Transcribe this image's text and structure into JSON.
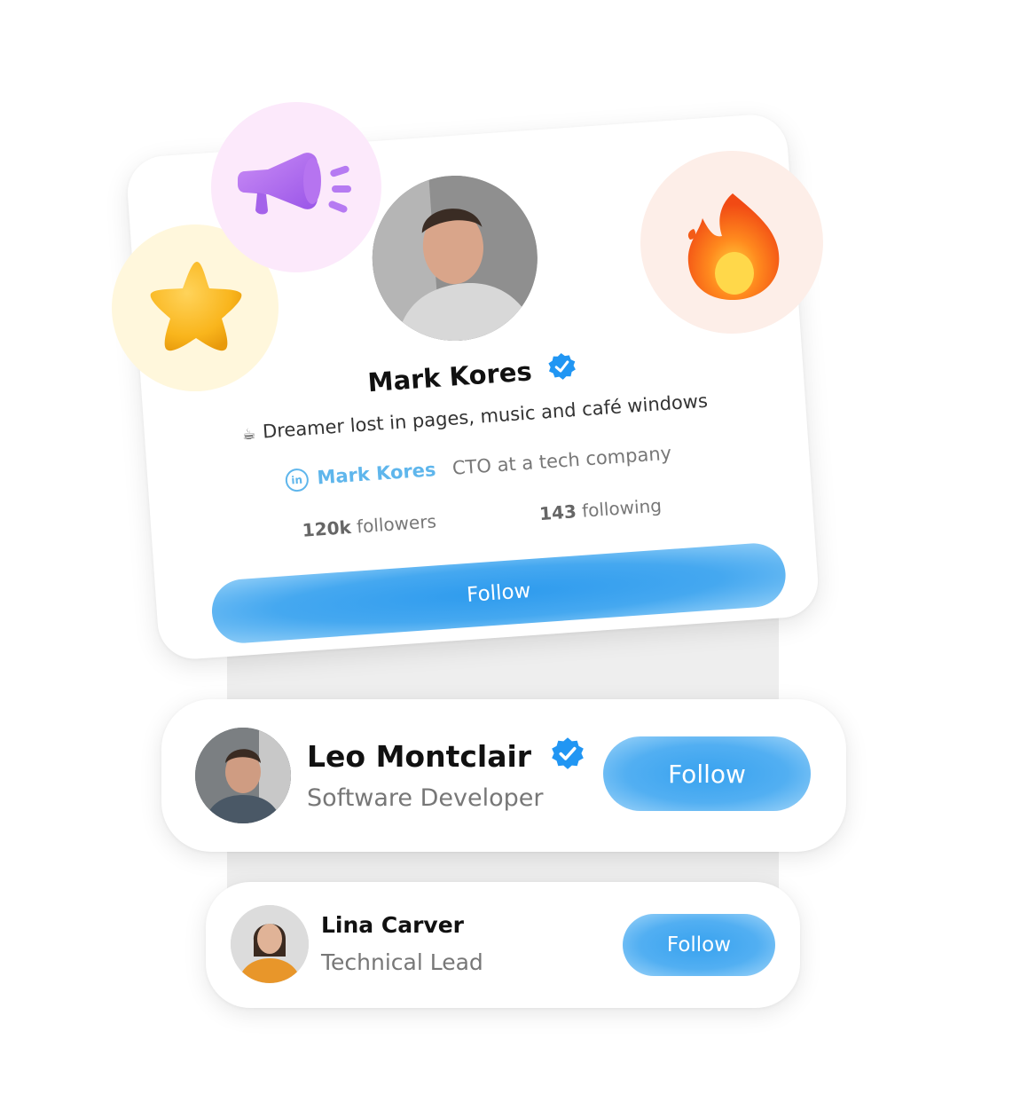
{
  "profile": {
    "name": "Mark Kores",
    "bio_icon": "☕",
    "bio": "Dreamer lost in pages, music and café windows",
    "linkedin_icon": "in",
    "linkedin_name": "Mark Kores",
    "job_title": "CTO at a tech company",
    "followers_count": "120k",
    "followers_label": "followers",
    "following_count": "143",
    "following_label": "following",
    "follow_label": "Follow",
    "verified": true
  },
  "decorations": {
    "icons": [
      "star-icon",
      "megaphone-icon",
      "fire-icon"
    ]
  },
  "suggestions": [
    {
      "name": "Leo Montclair",
      "role": "Software Developer",
      "verified": true,
      "follow_label": "Follow"
    },
    {
      "name": "Lina Carver",
      "role": "Technical Lead",
      "verified": false,
      "follow_label": "Follow"
    }
  ],
  "colors": {
    "accent": "#2e9bee",
    "link": "#5fb6ec",
    "verified": "#2196f3"
  }
}
